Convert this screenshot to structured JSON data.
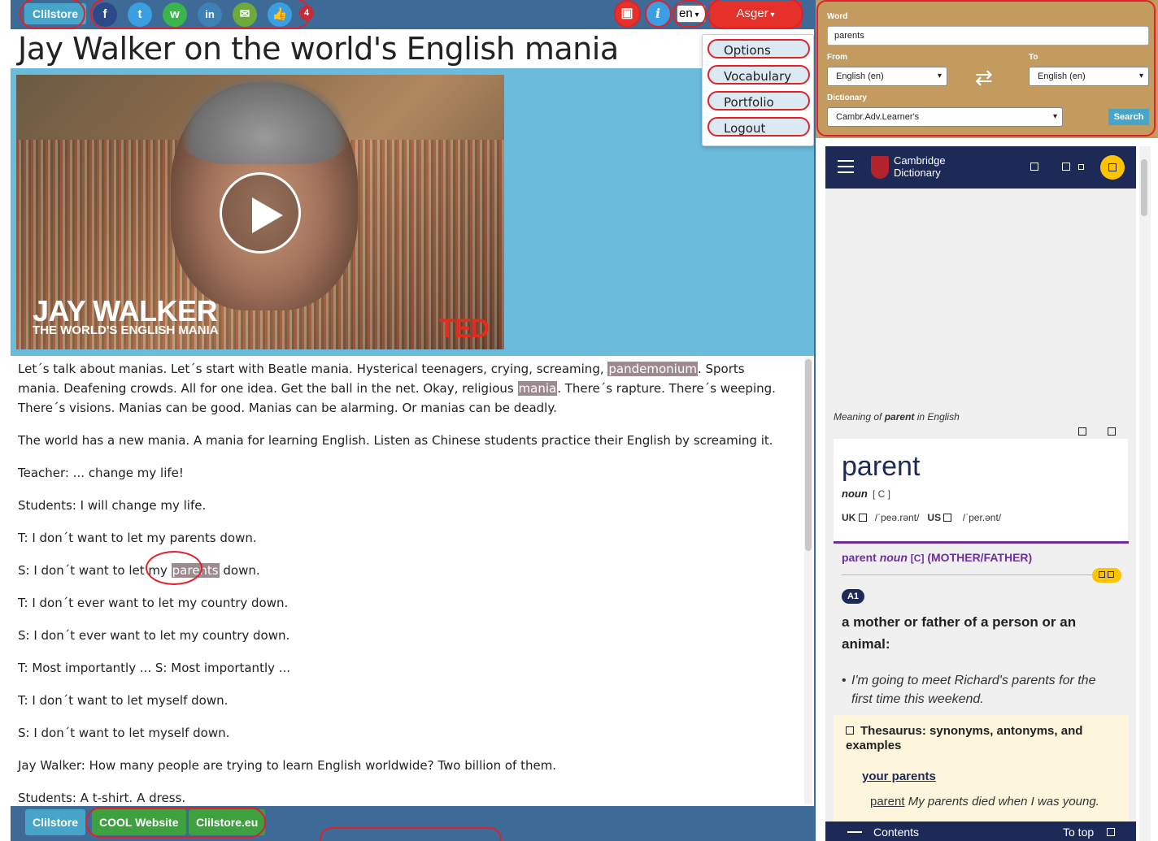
{
  "topbar": {
    "clilstore_label": "Clilstore",
    "share_icons": [
      "facebook-icon",
      "twitter-icon",
      "whatsapp-icon",
      "linkedin-icon",
      "email-icon",
      "like-icon"
    ],
    "likes_count": "4",
    "language": "en",
    "user": "Asger"
  },
  "menu": {
    "items": [
      "Options",
      "Vocabulary",
      "Portfolio",
      "Logout"
    ]
  },
  "page": {
    "title": "Jay Walker on the world's English mania"
  },
  "video": {
    "name_overlay": "JAY WALKER",
    "subtitle_overlay": "THE WORLD'S ENGLISH MANIA",
    "brand": "TED"
  },
  "transcript": {
    "p1_a": "Let´s talk about manias. Let´s start with Beatle mania. Hysterical teenagers, crying, screaming, ",
    "p1_hl1": "pandemonium",
    "p1_b": ". Sports mania. Deafening crowds. All for one idea. Get the ball in the net. Okay, religious ",
    "p1_hl2": "mania",
    "p1_c": ". There´s rapture. There´s weeping. There´s visions. Manias can be good. Manias can be alarming. Or manias can be deadly.",
    "p2": "The world has a new mania. A mania for learning English. Listen as Chinese students practice their English by screaming it.",
    "p3": "Teacher: ... change my life!",
    "p4": "Students: I will change my life.",
    "p5": "T: I don´t want to let my parents down.",
    "p6_a": "S: I don´t want to let my ",
    "p6_hl": "parents",
    "p6_b": " down.",
    "p7": "T: I don´t ever want to let my country down.",
    "p8": "S: I don´t ever want to let my country down.",
    "p9": "T: Most importantly ... S: Most importantly ...",
    "p10": "T: I don´t want to let myself down.",
    "p11": "S: I don´t want to let myself down.",
    "p12": "Jay Walker: How many people are trying to learn English worldwide? Two billion of them.",
    "p13": "Students: A t-shirt. A dress."
  },
  "bottombar": {
    "clilstore": "Clilstore",
    "cool": "COOL Website",
    "clilstore_eu": "Clilstore.eu"
  },
  "dict_form": {
    "word_label": "Word",
    "word_value": "parents",
    "from_label": "From",
    "from_value": "English (en)",
    "to_label": "To",
    "to_value": "English (en)",
    "dictionary_label": "Dictionary",
    "dictionary_value": "Cambr.Adv.Learner's",
    "search_label": "Search"
  },
  "cambridge": {
    "logo_line1": "Cambridge",
    "logo_line2": "Dictionary",
    "meaning_a": "Meaning of ",
    "meaning_word": "parent",
    "meaning_b": " in English",
    "headword": "parent",
    "pos": "noun",
    "grammar": "[ C ]",
    "uk_label": "UK",
    "uk_ipa": "/ˈpeə.rənt/",
    "us_label": "US",
    "us_ipa": "/ˈper.ənt/",
    "sense_word": "parent",
    "sense_pos": "noun",
    "sense_tag": "[C]",
    "sense_guide": "(MOTHER/FATHER)",
    "level": "A1",
    "definition": "a mother or father of a person or an animal:",
    "example": "I'm going to meet Richard's parents for the first time this weekend.",
    "thesaurus_title": "Thesaurus: synonyms, antonyms, and examples",
    "thesaurus_sub": "your parents",
    "thesaurus_kw": "parent",
    "thesaurus_ex": " My parents died when I was young.",
    "footer_contents": "Contents",
    "footer_top": "To top"
  },
  "colors": {
    "topbar": "#3d6a96",
    "clil_blue": "#46a5c8",
    "user_red": "#e6302a",
    "highlight": "#9c8a8f",
    "dict_bg": "#c39b5e",
    "cambridge_navy": "#1d2a57",
    "annotation_red": "#e0202b"
  }
}
